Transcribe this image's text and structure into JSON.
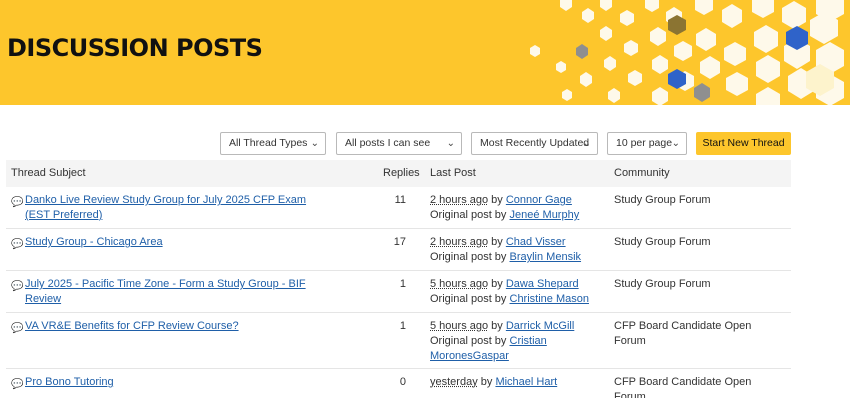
{
  "banner": {
    "title": "DISCUSSION POSTS",
    "colors": {
      "background": "#fdc62c",
      "hex_light": "#ffffff",
      "hex_blue": "#2f63c9",
      "hex_gray": "#8f8f8f",
      "hex_brown": "#8b7432"
    }
  },
  "filters": {
    "thread_types": "All Thread Types",
    "visibility": "All posts I can see",
    "sort": "Most Recently Updated",
    "per_page": "10 per page",
    "start_thread": "Start New Thread",
    "chevron_icon": "chevron-down-icon"
  },
  "table": {
    "headers": {
      "subject": "Thread Subject",
      "replies": "Replies",
      "last_post": "Last Post",
      "community": "Community"
    },
    "by_text": "by",
    "original_post_text": "Original post by",
    "rows": [
      {
        "subject": "Danko Live Review Study Group for July 2025 CFP Exam (EST Preferred)",
        "replies": "11",
        "time": "2 hours ago",
        "last_by": "Connor Gage",
        "original_by": "Jeneé Murphy",
        "community": "Study Group Forum"
      },
      {
        "subject": "Study Group - Chicago Area",
        "replies": "17",
        "time": "2 hours ago",
        "last_by": "Chad Visser",
        "original_by": "Braylin Mensik",
        "community": "Study Group Forum"
      },
      {
        "subject": "July 2025 - Pacific Time Zone - Form a Study Group - BIF Review",
        "replies": "1",
        "time": "5 hours ago",
        "last_by": "Dawa Shepard",
        "original_by": "Christine Mason",
        "community": "Study Group Forum"
      },
      {
        "subject": "VA VR&E Benefits for CFP Review Course?",
        "replies": "1",
        "time": "5 hours ago",
        "last_by": "Darrick McGill",
        "original_by": "Cristian MoronesGaspar",
        "community": "CFP Board Candidate Open Forum"
      },
      {
        "subject": "Pro Bono Tutoring",
        "replies": "0",
        "time": "yesterday",
        "last_by": "Michael Hart",
        "original_by": "",
        "community": "CFP Board Candidate Open Forum"
      }
    ]
  }
}
